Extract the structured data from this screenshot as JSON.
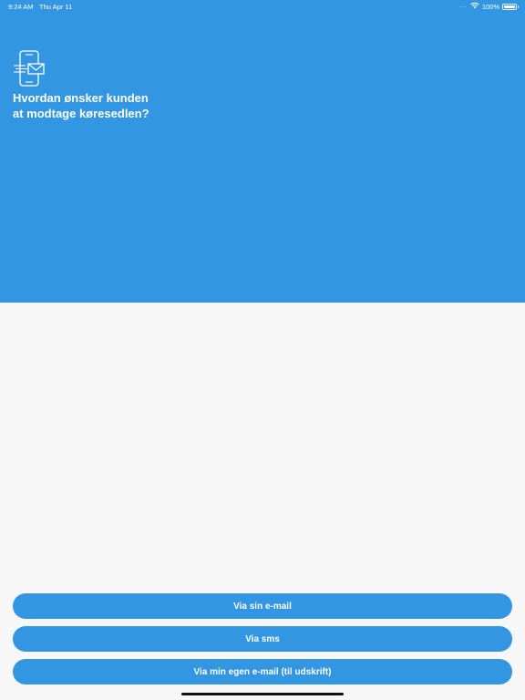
{
  "status_bar": {
    "time": "9:24 AM",
    "date": "Thu Apr 11",
    "battery": "100%",
    "signal_dots": "....",
    "battery_level": 1.0
  },
  "header": {
    "icon": "phone-email-icon",
    "title_line1": "Hvordan ønsker kunden",
    "title_line2": "at modtage køresedlen?"
  },
  "options": {
    "email_label": "Via sin e-mail",
    "sms_label": "Via sms",
    "own_email_label": "Via min egen e-mail (til udskrift)"
  },
  "colors": {
    "accent": "#3396e3",
    "background": "#f7f7f7",
    "text_on_accent": "#ffffff"
  }
}
